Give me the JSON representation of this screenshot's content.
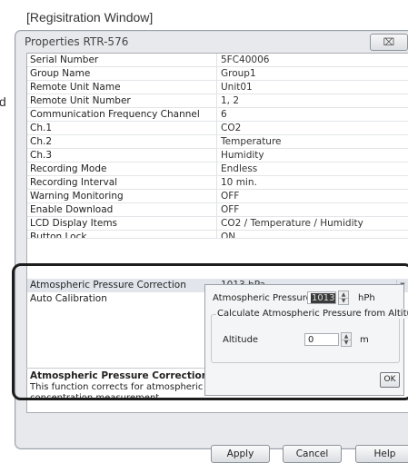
{
  "caption": "[Regisitration Window]",
  "side_letter": "d",
  "window": {
    "title": "Properties RTR-576",
    "close_glyph": "⌧"
  },
  "properties": [
    {
      "name": "Serial Number",
      "value": "5FC40006"
    },
    {
      "name": "Group Name",
      "value": "Group1"
    },
    {
      "name": "Remote Unit Name",
      "value": "Unit01"
    },
    {
      "name": "Remote Unit Number",
      "value": "1, 2"
    },
    {
      "name": "Communication Frequency Channel",
      "value": "6"
    },
    {
      "name": "Ch.1",
      "value": "CO2"
    },
    {
      "name": "Ch.2",
      "value": "Temperature"
    },
    {
      "name": "Ch.3",
      "value": "Humidity"
    },
    {
      "name": "Recording Mode",
      "value": "Endless"
    },
    {
      "name": "Recording Interval",
      "value": "10 min."
    },
    {
      "name": "Warning Monitoring",
      "value": "OFF"
    },
    {
      "name": "Enable Download",
      "value": "OFF"
    },
    {
      "name": "LCD Display Items",
      "value": "CO2 / Temperature / Humidity"
    },
    {
      "name": "Button Lock",
      "value": "ON"
    },
    {
      "name": "Atmospheric Pressure Correction",
      "value": "1013 hPa"
    },
    {
      "name": "Auto Calibration",
      "value": ""
    }
  ],
  "description": {
    "title": "Atmospheric Pressure Correction",
    "line1": "This function corrects for atmospheric pre",
    "line2": "concentration measurement."
  },
  "popup": {
    "pressure_label": "Atmospheric Pressure",
    "pressure_value": "1013",
    "pressure_unit": "hPh",
    "group_title": "Calculate Atmospheric Pressure from Altitude",
    "altitude_label": "Altitude",
    "altitude_value": "0",
    "altitude_unit": "m",
    "ok_label": "OK"
  },
  "buttons": {
    "apply": "Apply",
    "cancel": "Cancel",
    "help": "Help"
  },
  "icons": {
    "spin_up": "▲",
    "spin_down": "▼",
    "dropdown": "▼"
  }
}
